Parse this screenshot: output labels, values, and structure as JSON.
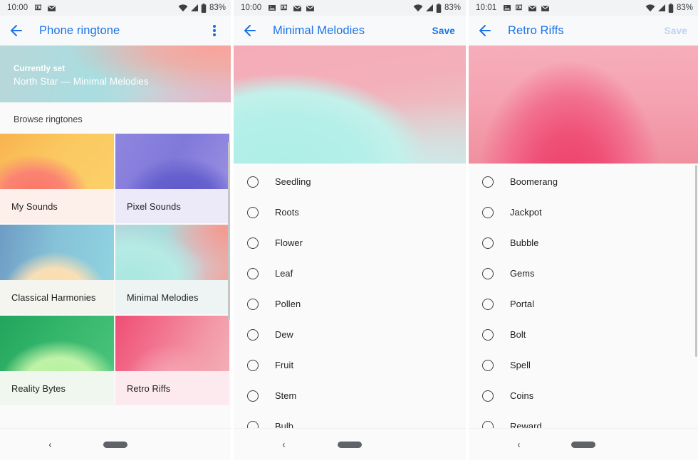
{
  "screens": [
    {
      "id": "phone-ringtone-picker",
      "statusbar": {
        "clock": "10:00",
        "left_icons": [
          "photo-icon",
          "location-share-icon",
          "mail-icon"
        ],
        "right_icons": [
          "wifi-icon",
          "signal-icon",
          "battery-icon"
        ],
        "battery": "83%"
      },
      "appbar": {
        "back_icon": "back-arrow-icon",
        "title": "Phone ringtone",
        "overflow_icon": "more-vert-icon"
      },
      "current": {
        "label": "Currently set",
        "value": "North Star — Minimal Melodies"
      },
      "browse_heading": "Browse ringtones",
      "tiles": [
        {
          "label": "My Sounds",
          "art": "art-mysounds",
          "bar": "lbl-mysounds"
        },
        {
          "label": "Pixel Sounds",
          "art": "art-pixel",
          "bar": "lbl-pixel"
        },
        {
          "label": "Classical Harmonies",
          "art": "art-classical",
          "bar": "lbl-classical"
        },
        {
          "label": "Minimal Melodies",
          "art": "art-minimal",
          "bar": "lbl-minimal"
        },
        {
          "label": "Reality Bytes",
          "art": "art-reality",
          "bar": "lbl-reality"
        },
        {
          "label": "Retro Riffs",
          "art": "art-retro",
          "bar": "lbl-retro"
        }
      ]
    },
    {
      "id": "minimal-melodies-list",
      "statusbar": {
        "clock": "10:00",
        "left_icons": [
          "photo-icon",
          "location-share-icon",
          "mail-icon",
          "mail-icon"
        ],
        "right_icons": [
          "wifi-icon",
          "signal-icon",
          "battery-icon"
        ],
        "battery": "83%"
      },
      "appbar": {
        "back_icon": "back-arrow-icon",
        "title": "Minimal Melodies",
        "save_label": "Save",
        "save_enabled": true
      },
      "hero": "hero-minimal",
      "items": [
        "Seedling",
        "Roots",
        "Flower",
        "Leaf",
        "Pollen",
        "Dew",
        "Fruit",
        "Stem",
        "Bulb"
      ]
    },
    {
      "id": "retro-riffs-list",
      "statusbar": {
        "clock": "10:01",
        "left_icons": [
          "photo-icon",
          "location-share-icon",
          "mail-icon",
          "mail-icon"
        ],
        "right_icons": [
          "wifi-icon",
          "signal-icon",
          "battery-icon"
        ],
        "battery": "83%"
      },
      "appbar": {
        "back_icon": "back-arrow-icon",
        "title": "Retro Riffs",
        "save_label": "Save",
        "save_enabled": false
      },
      "hero": "hero-retro",
      "items": [
        "Boomerang",
        "Jackpot",
        "Bubble",
        "Gems",
        "Portal",
        "Bolt",
        "Spell",
        "Coins",
        "Reward"
      ]
    }
  ],
  "navbar": {
    "back_label": "‹",
    "home_pill": "home-pill"
  },
  "colors": {
    "accent": "#1a73e8",
    "accent_disabled": "#b9d3f6",
    "surface": "#fafafa",
    "statusbar_bg": "#f1f3f4",
    "appbar_bg": "#f8f9fa",
    "text_primary": "#202124",
    "text_secondary": "#3c4043"
  }
}
